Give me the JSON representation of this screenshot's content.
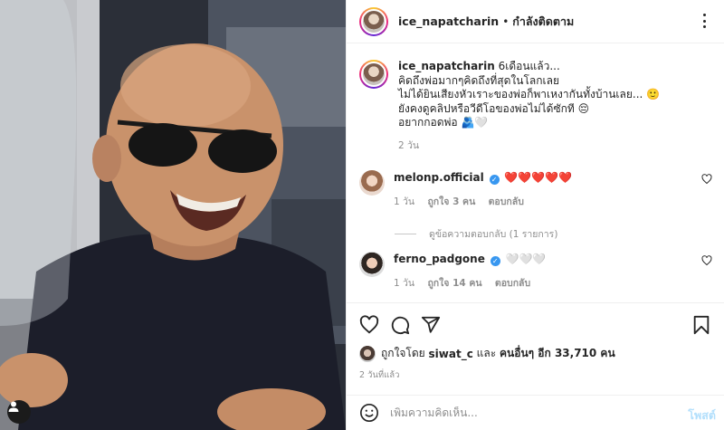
{
  "post": {
    "username": "ice_napatcharin",
    "follow_status": "กำลังติดตาม",
    "separator": "•",
    "caption": {
      "username": "ice_napatcharin",
      "lines": [
        "6เดือนแล้ว...",
        "คิดถึงพ่อมากๆคิดถึงที่สุดในโลกเลย",
        "ไม่ได้ยินเสียงหัวเราะของพ่อก็พาเหงากันทั้งบ้านเลย... 🙂",
        "ยังคงดูคลิปหรือวีดีโอของพ่อไม่ได้ซักที 😔",
        "อยากกอดพ่อ 🫂🤍"
      ],
      "time": "2 วัน"
    },
    "comments": [
      {
        "username": "melonp.official",
        "text": "❤️❤️❤️❤️❤️",
        "time": "1 วัน",
        "likes": "ถูกใจ 3 คน",
        "reply_label": "ตอบกลับ"
      },
      {
        "username": "ferno_padgone",
        "text": "🤍🤍🤍",
        "time": "1 วัน",
        "likes": "ถูกใจ 14 คน",
        "reply_label": "ตอบกลับ"
      }
    ],
    "view_replies": "ดูข้อความตอบกลับ (1 รายการ)",
    "likes_summary": {
      "prefix": "ถูกใจโดย",
      "user": "siwat_c",
      "middle": "และ",
      "others": "คนอื่นๆ อีก 33,710 คน"
    },
    "posted_time": "2 วันที่แล้ว",
    "comment_input": {
      "placeholder": "เพิ่มความคิดเห็น...",
      "post_label": "โพสต์"
    }
  },
  "colors": {
    "accent": "#3897f0",
    "heart": "#e0222c",
    "muted": "#8e8e8e",
    "post_disabled": "#b2dffc"
  },
  "icons": [
    "more-icon",
    "verified-icon",
    "heart-icon",
    "comment-icon",
    "share-icon",
    "save-icon",
    "emoji-icon",
    "user-tag-icon"
  ]
}
